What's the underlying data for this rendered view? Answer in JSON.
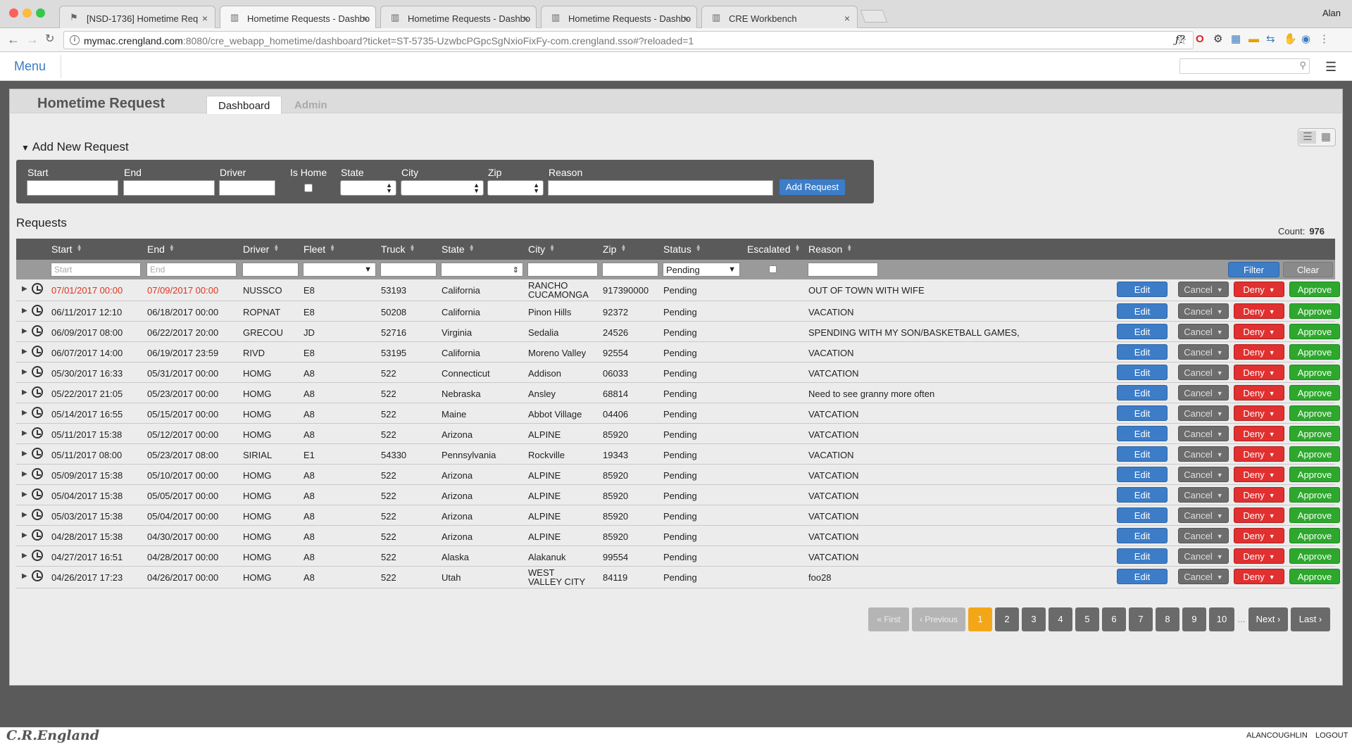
{
  "browser": {
    "tabs": [
      {
        "title": "[NSD-1736] Hometime Req",
        "icon": "jira-icon"
      },
      {
        "title": "Hometime Requests - Dashbo",
        "icon": "building-icon"
      },
      {
        "title": "Hometime Requests - Dashbo",
        "icon": "building-icon"
      },
      {
        "title": "Hometime Requests - Dashbo",
        "icon": "building-icon"
      },
      {
        "title": "CRE Workbench",
        "icon": "building-icon"
      }
    ],
    "user": "Alan",
    "url_host": "mymac.crengland.com",
    "url_rest": ":8080/cre_webapp_hometime/dashboard?ticket=ST-5735-UzwbcPGpcSgNxioFixFy-com.crengland.sso#?reloaded=1"
  },
  "header": {
    "menu_label": "Menu"
  },
  "app": {
    "title": "Hometime Request",
    "tabs": {
      "dashboard": "Dashboard",
      "admin": "Admin"
    }
  },
  "add_request": {
    "title": "Add New Request",
    "labels": {
      "start": "Start",
      "end": "End",
      "driver": "Driver",
      "is_home": "Is Home",
      "state": "State",
      "city": "City",
      "zip": "Zip",
      "reason": "Reason"
    },
    "button": "Add Request"
  },
  "requests": {
    "title": "Requests",
    "count_label": "Count:",
    "count": "976",
    "columns": {
      "start": "Start",
      "end": "End",
      "driver": "Driver",
      "fleet": "Fleet",
      "truck": "Truck",
      "state": "State",
      "city": "City",
      "zip": "Zip",
      "status": "Status",
      "escalated": "Escalated",
      "reason": "Reason"
    },
    "filter": {
      "start_placeholder": "Start",
      "end_placeholder": "End",
      "status_value": "Pending",
      "filter_button": "Filter",
      "clear_button": "Clear"
    },
    "actions": {
      "edit": "Edit",
      "cancel": "Cancel",
      "deny": "Deny",
      "approve": "Approve"
    },
    "rows": [
      {
        "start": "07/01/2017 00:00",
        "end": "07/09/2017 00:00",
        "driver": "NUSSCO",
        "fleet": "E8",
        "truck": "53193",
        "state": "California",
        "city": "RANCHO CUCAMONGA",
        "zip": "917390000",
        "status": "Pending",
        "reason": "OUT OF TOWN WITH WIFE"
      },
      {
        "start": "06/11/2017 12:10",
        "end": "06/18/2017 00:00",
        "driver": "ROPNAT",
        "fleet": "E8",
        "truck": "50208",
        "state": "California",
        "city": "Pinon Hills",
        "zip": "92372",
        "status": "Pending",
        "reason": "VACATION"
      },
      {
        "start": "06/09/2017 08:00",
        "end": "06/22/2017 20:00",
        "driver": "GRECOU",
        "fleet": "JD",
        "truck": "52716",
        "state": "Virginia",
        "city": "Sedalia",
        "zip": "24526",
        "status": "Pending",
        "reason": "SPENDING WITH MY SON/BASKETBALL GAMES,"
      },
      {
        "start": "06/07/2017 14:00",
        "end": "06/19/2017 23:59",
        "driver": "RIVD",
        "fleet": "E8",
        "truck": "53195",
        "state": "California",
        "city": "Moreno Valley",
        "zip": "92554",
        "status": "Pending",
        "reason": "VACATION"
      },
      {
        "start": "05/30/2017 16:33",
        "end": "05/31/2017 00:00",
        "driver": "HOMG",
        "fleet": "A8",
        "truck": "522",
        "state": "Connecticut",
        "city": "Addison",
        "zip": "06033",
        "status": "Pending",
        "reason": "VATCATION"
      },
      {
        "start": "05/22/2017 21:05",
        "end": "05/23/2017 00:00",
        "driver": "HOMG",
        "fleet": "A8",
        "truck": "522",
        "state": "Nebraska",
        "city": "Ansley",
        "zip": "68814",
        "status": "Pending",
        "reason": "Need to see granny more often"
      },
      {
        "start": "05/14/2017 16:55",
        "end": "05/15/2017 00:00",
        "driver": "HOMG",
        "fleet": "A8",
        "truck": "522",
        "state": "Maine",
        "city": "Abbot Village",
        "zip": "04406",
        "status": "Pending",
        "reason": "VATCATION"
      },
      {
        "start": "05/11/2017 15:38",
        "end": "05/12/2017 00:00",
        "driver": "HOMG",
        "fleet": "A8",
        "truck": "522",
        "state": "Arizona",
        "city": "ALPINE",
        "zip": "85920",
        "status": "Pending",
        "reason": "VATCATION"
      },
      {
        "start": "05/11/2017 08:00",
        "end": "05/23/2017 08:00",
        "driver": "SIRIAL",
        "fleet": "E1",
        "truck": "54330",
        "state": "Pennsylvania",
        "city": "Rockville",
        "zip": "19343",
        "status": "Pending",
        "reason": "VACATION"
      },
      {
        "start": "05/09/2017 15:38",
        "end": "05/10/2017 00:00",
        "driver": "HOMG",
        "fleet": "A8",
        "truck": "522",
        "state": "Arizona",
        "city": "ALPINE",
        "zip": "85920",
        "status": "Pending",
        "reason": "VATCATION"
      },
      {
        "start": "05/04/2017 15:38",
        "end": "05/05/2017 00:00",
        "driver": "HOMG",
        "fleet": "A8",
        "truck": "522",
        "state": "Arizona",
        "city": "ALPINE",
        "zip": "85920",
        "status": "Pending",
        "reason": "VATCATION"
      },
      {
        "start": "05/03/2017 15:38",
        "end": "05/04/2017 00:00",
        "driver": "HOMG",
        "fleet": "A8",
        "truck": "522",
        "state": "Arizona",
        "city": "ALPINE",
        "zip": "85920",
        "status": "Pending",
        "reason": "VATCATION"
      },
      {
        "start": "04/28/2017 15:38",
        "end": "04/30/2017 00:00",
        "driver": "HOMG",
        "fleet": "A8",
        "truck": "522",
        "state": "Arizona",
        "city": "ALPINE",
        "zip": "85920",
        "status": "Pending",
        "reason": "VATCATION"
      },
      {
        "start": "04/27/2017 16:51",
        "end": "04/28/2017 00:00",
        "driver": "HOMG",
        "fleet": "A8",
        "truck": "522",
        "state": "Alaska",
        "city": "Alakanuk",
        "zip": "99554",
        "status": "Pending",
        "reason": "VATCATION"
      },
      {
        "start": "04/26/2017 17:23",
        "end": "04/26/2017 00:00",
        "driver": "HOMG",
        "fleet": "A8",
        "truck": "522",
        "state": "Utah",
        "city": "WEST VALLEY CITY",
        "zip": "84119",
        "status": "Pending",
        "reason": "foo28"
      }
    ]
  },
  "pagination": {
    "first": "« First",
    "previous": "‹ Previous",
    "pages": [
      "1",
      "2",
      "3",
      "4",
      "5",
      "6",
      "7",
      "8",
      "9",
      "10"
    ],
    "current": "1",
    "ellipsis": "...",
    "next": "Next ›",
    "last": "Last ›"
  },
  "footer": {
    "logo": "C.R.England",
    "username": "ALANCOUGHLIN",
    "logout": "LOGOUT"
  },
  "colors": {
    "edit": "#3d7dc8",
    "cancel": "#6d6d6d",
    "deny": "#e03030",
    "approve": "#2da82d",
    "current_page": "#f3a718",
    "overdue_date": "#e0331f"
  }
}
